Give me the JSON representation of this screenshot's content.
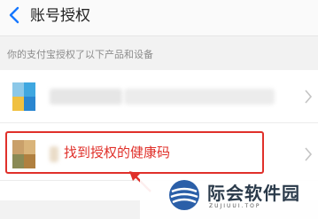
{
  "header": {
    "title": "账号授权"
  },
  "subheader": {
    "text": "你的支付宝授权了以下产品和设备"
  },
  "annotation": {
    "text": "找到授权的健康码"
  },
  "watermark": {
    "brand": "际会软件园",
    "url": "ZUJIUUI.TOP"
  },
  "icons": {
    "back": "chevron-left-icon",
    "row_chevron": "chevron-right-icon",
    "logo": "globe-logo-icon"
  },
  "colors": {
    "annotation_red": "#e0302a",
    "back_blue": "#1677ff"
  }
}
